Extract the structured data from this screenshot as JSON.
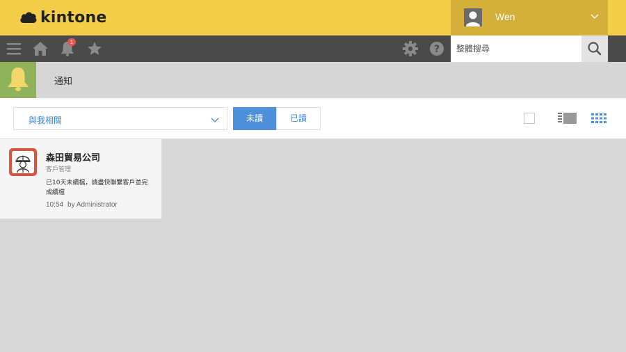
{
  "header": {
    "logo_text": "kintone",
    "user_name": "Wen"
  },
  "toolbar": {
    "notification_count": "1",
    "search_placeholder": "整體搜尋"
  },
  "notification_page": {
    "title": "通知"
  },
  "filter": {
    "dropdown_value": "與我相關",
    "tab_unread": "未讀",
    "tab_read": "已讀"
  },
  "notifications": [
    {
      "title": "森田貿易公司",
      "app_name": "客戶管理",
      "message": "已10天未續檔，請盡快聯繫客戶並完成續檔",
      "time": "10:54",
      "by": "by Administrator"
    }
  ],
  "colors": {
    "brand_yellow": "#f4cd49",
    "toolbar_dark": "#4a4a4a",
    "accent_blue": "#4d8fd8",
    "bell_green": "#8fb35a",
    "badge_red": "#e5574e"
  }
}
